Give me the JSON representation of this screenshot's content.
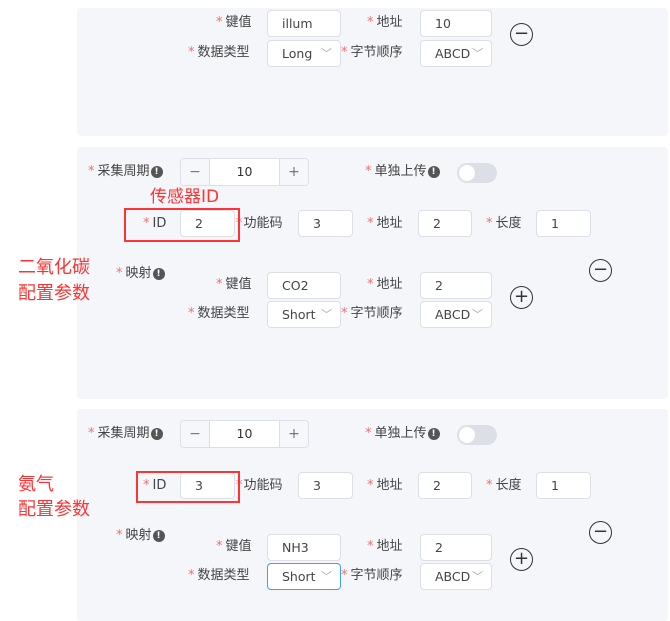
{
  "panel1": {
    "key_label": "键值",
    "key_value": "illum",
    "addr_label": "地址",
    "addr_value": "10",
    "type_label": "数据类型",
    "type_value": "Long",
    "order_label": "字节顺序",
    "order_value": "ABCD"
  },
  "panels": [
    {
      "period_label": "采集周期",
      "period_value": "10",
      "upload_label": "单独上传",
      "upload_on": false,
      "id_label": "ID",
      "id_value": "2",
      "func_label": "功能码",
      "func_value": "3",
      "addr_label": "地址",
      "addr_value": "2",
      "len_label": "长度",
      "len_value": "1",
      "map_label": "映射",
      "key_label": "键值",
      "key_value": "CO2",
      "maddr_label": "地址",
      "maddr_value": "2",
      "type_label": "数据类型",
      "type_value": "Short",
      "order_label": "字节顺序",
      "order_value": "ABCD"
    },
    {
      "period_label": "采集周期",
      "period_value": "10",
      "upload_label": "单独上传",
      "upload_on": false,
      "id_label": "ID",
      "id_value": "3",
      "func_label": "功能码",
      "func_value": "3",
      "addr_label": "地址",
      "addr_value": "2",
      "len_label": "长度",
      "len_value": "1",
      "map_label": "映射",
      "key_label": "键值",
      "key_value": "NH3",
      "maddr_label": "地址",
      "maddr_value": "2",
      "type_label": "数据类型",
      "type_value": "Short",
      "order_label": "字节顺序",
      "order_value": "ABCD"
    }
  ],
  "annotations": {
    "sensor_id": "传感器ID",
    "co2_line1": "二氧化碳",
    "co2_line2": "配置参数",
    "nh3_line1": "氨气",
    "nh3_line2": "配置参数"
  },
  "colors": {
    "annotation": "#ff3333",
    "required": "#f56c6c",
    "focus": "#409eff"
  }
}
